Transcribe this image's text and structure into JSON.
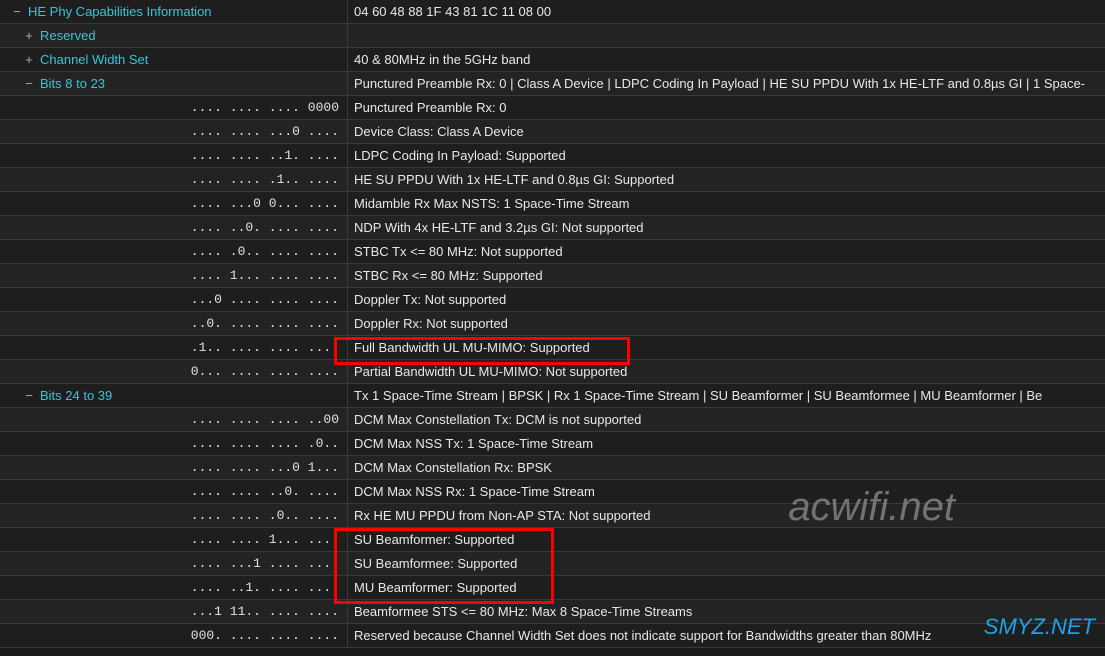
{
  "watermark_big": "acwifi.net",
  "watermark_small": "SMYZ.NET",
  "rows": [
    {
      "kind": "parent",
      "icon": "−",
      "indent": 10,
      "label": "HE Phy Capabilities Information",
      "color": "cyan",
      "value": "04 60 48 88 1F 43 81 1C 11 08 00"
    },
    {
      "kind": "parent",
      "icon": "+",
      "indent": 22,
      "label": "Reserved",
      "color": "cyan",
      "value": ""
    },
    {
      "kind": "parent",
      "icon": "+",
      "indent": 22,
      "label": "Channel Width Set",
      "color": "cyan",
      "value": "40 & 80MHz in the 5GHz band"
    },
    {
      "kind": "parent",
      "icon": "−",
      "indent": 22,
      "label": "Bits 8 to 23",
      "color": "cyan",
      "value": "Punctured Preamble Rx: 0   |   Class A Device   |   LDPC Coding In Payload   |   HE SU PPDU With 1x HE-LTF and 0.8µs GI   |   1 Space-"
    },
    {
      "kind": "bits",
      "bits": ".... .... .... 0000",
      "value": "Punctured Preamble Rx: 0"
    },
    {
      "kind": "bits",
      "bits": ".... .... ...0 ....",
      "value": "Device Class: Class A Device"
    },
    {
      "kind": "bits",
      "bits": ".... .... ..1. ....",
      "value": "LDPC Coding In Payload: Supported"
    },
    {
      "kind": "bits",
      "bits": ".... .... .1.. ....",
      "value": "HE SU PPDU With 1x HE-LTF and 0.8µs GI: Supported"
    },
    {
      "kind": "bits",
      "bits": ".... ...0 0... ....",
      "value": "Midamble Rx Max NSTS: 1 Space-Time Stream"
    },
    {
      "kind": "bits",
      "bits": ".... ..0. .... ....",
      "value": "NDP With 4x HE-LTF and 3.2µs GI: Not supported"
    },
    {
      "kind": "bits",
      "bits": ".... .0.. .... ....",
      "value": "STBC Tx <= 80 MHz: Not supported"
    },
    {
      "kind": "bits",
      "bits": ".... 1... .... ....",
      "value": "STBC Rx <= 80 MHz: Supported"
    },
    {
      "kind": "bits",
      "bits": "...0 .... .... ....",
      "value": "Doppler Tx: Not supported"
    },
    {
      "kind": "bits",
      "bits": "..0. .... .... ....",
      "value": "Doppler Rx: Not supported"
    },
    {
      "kind": "bits",
      "bits": ".1.. .... .... ....",
      "value": "Full Bandwidth UL MU-MIMO: Supported"
    },
    {
      "kind": "bits",
      "bits": "0... .... .... ....",
      "value": "Partial Bandwidth UL MU-MIMO: Not supported"
    },
    {
      "kind": "parent",
      "icon": "−",
      "indent": 22,
      "label": "Bits 24 to 39",
      "color": "cyan",
      "value": "Tx 1 Space-Time Stream   |   BPSK   |   Rx 1 Space-Time Stream   |   SU Beamformer   |   SU Beamformee   |   MU Beamformer   |   Be"
    },
    {
      "kind": "bits",
      "bits": ".... .... .... ..00",
      "value": "DCM Max Constellation Tx: DCM is not supported"
    },
    {
      "kind": "bits",
      "bits": ".... .... .... .0..",
      "value": "DCM Max NSS Tx: 1 Space-Time Stream"
    },
    {
      "kind": "bits",
      "bits": ".... .... ...0 1...",
      "value": "DCM Max Constellation Rx: BPSK"
    },
    {
      "kind": "bits",
      "bits": ".... .... ..0. ....",
      "value": "DCM Max NSS Rx: 1 Space-Time Stream"
    },
    {
      "kind": "bits",
      "bits": ".... .... .0.. ....",
      "value": "Rx HE MU PPDU from Non-AP STA: Not supported"
    },
    {
      "kind": "bits",
      "bits": ".... .... 1... ....",
      "value": "SU Beamformer: Supported"
    },
    {
      "kind": "bits",
      "bits": ".... ...1 .... ....",
      "value": "SU Beamformee: Supported"
    },
    {
      "kind": "bits",
      "bits": ".... ..1. .... ....",
      "value": "MU Beamformer: Supported"
    },
    {
      "kind": "bits",
      "bits": "...1 11.. .... ....",
      "value": "Beamformee STS <= 80 MHz: Max 8 Space-Time Streams"
    },
    {
      "kind": "bits",
      "bits": "000. .... .... ....",
      "value": "Reserved because Channel Width Set does not indicate support for Bandwidths greater than 80MHz"
    }
  ]
}
